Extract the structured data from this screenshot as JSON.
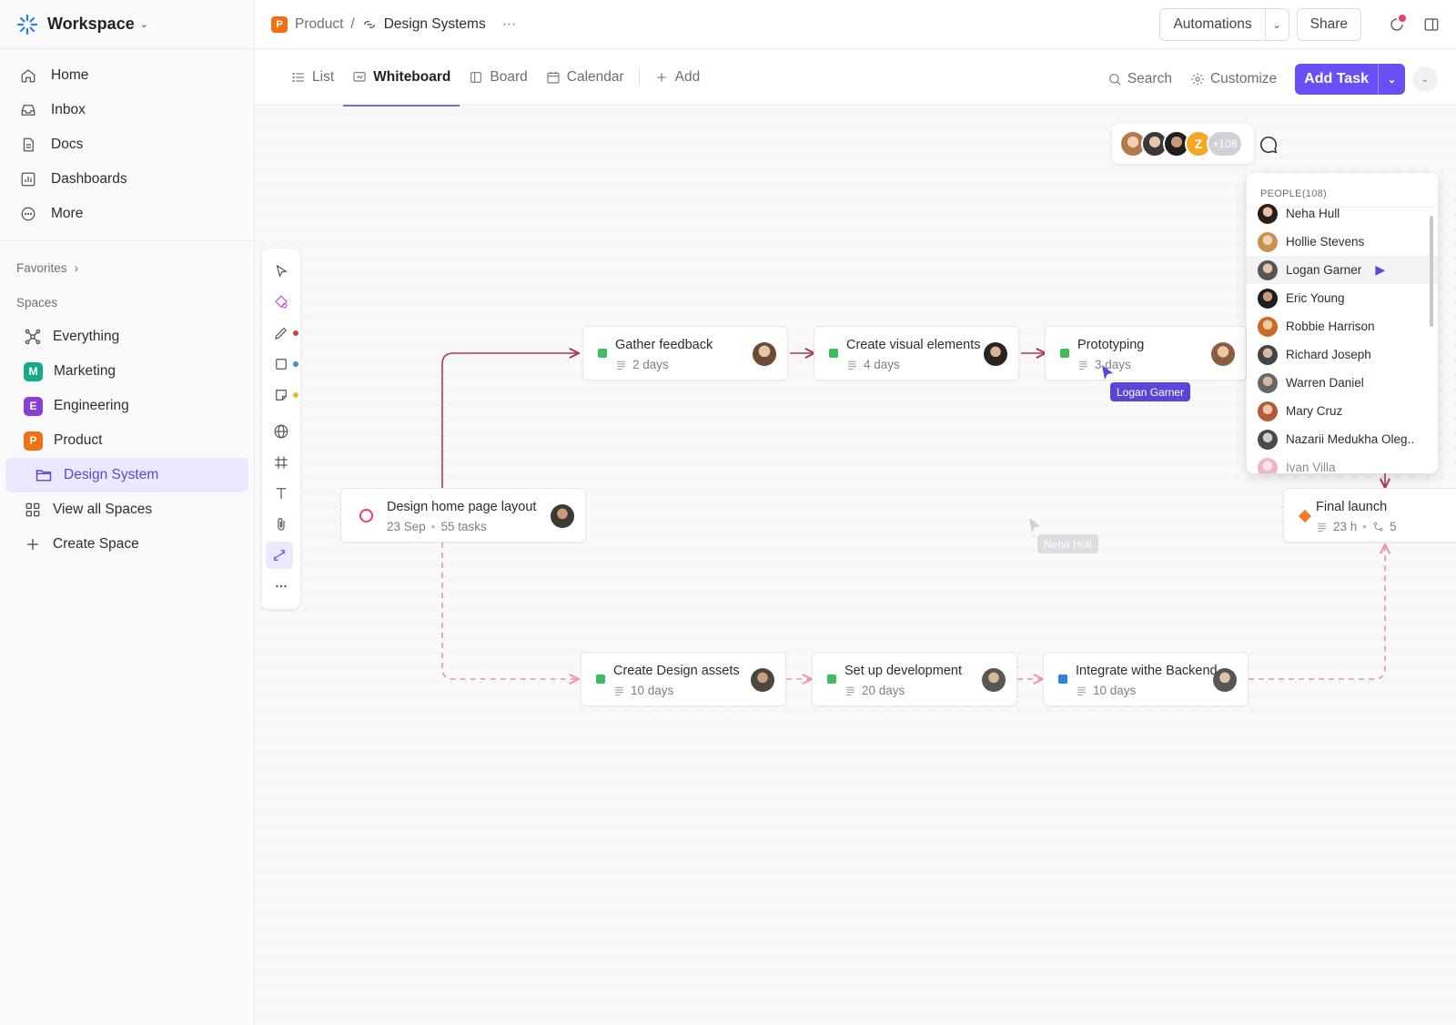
{
  "workspace": {
    "name": "Workspace"
  },
  "nav": [
    {
      "label": "Home",
      "icon": "home-icon"
    },
    {
      "label": "Inbox",
      "icon": "inbox-icon"
    },
    {
      "label": "Docs",
      "icon": "docs-icon"
    },
    {
      "label": "Dashboards",
      "icon": "dashboards-icon"
    },
    {
      "label": "More",
      "icon": "more-icon"
    }
  ],
  "favorites_label": "Favorites",
  "spaces_label": "Spaces",
  "spaces": [
    {
      "label": "Everything",
      "icon": "everything-icon"
    },
    {
      "label": "Marketing",
      "letter": "M",
      "color": "#17a98a"
    },
    {
      "label": "Engineering",
      "letter": "E",
      "color": "#8a3fd1"
    },
    {
      "label": "Product",
      "letter": "P",
      "color": "#f07014"
    },
    {
      "label": "Design System",
      "icon": "folder-icon",
      "selected": true
    },
    {
      "label": "View all Spaces",
      "icon": "grid-icon"
    },
    {
      "label": "Create Space",
      "icon": "plus-icon"
    }
  ],
  "breadcrumb": {
    "space": "Product",
    "space_letter": "P",
    "separator": "/",
    "page": "Design Systems",
    "more": "···"
  },
  "header": {
    "automations": "Automations",
    "share": "Share"
  },
  "views": {
    "tabs": [
      {
        "label": "List",
        "icon": "list-icon"
      },
      {
        "label": "Whiteboard",
        "icon": "whiteboard-icon",
        "active": true
      },
      {
        "label": "Board",
        "icon": "board-icon"
      },
      {
        "label": "Calendar",
        "icon": "calendar-icon"
      }
    ],
    "add": "Add",
    "search": "Search",
    "customize": "Customize",
    "add_task": "Add Task"
  },
  "tool_colors": {
    "pen": "#d0463b",
    "shape": "#3c8fe0",
    "sticky": "#f2b53c"
  },
  "cards": {
    "gather": {
      "title": "Gather feedback",
      "meta": "2 days",
      "color": "#3ebd5d"
    },
    "visual": {
      "title": "Create visual elements",
      "meta": "4 days",
      "color": "#3ebd5d"
    },
    "proto": {
      "title": "Prototyping",
      "meta": "3 days",
      "color": "#3ebd5d"
    },
    "home": {
      "title": "Design home page layout",
      "date": "23 Sep",
      "dot": "•",
      "tasks": "55 tasks",
      "color": "#e9406b"
    },
    "final": {
      "title": "Final launch",
      "hours": "23 h",
      "dot": "•",
      "deps": "5",
      "color": "#f07b2a"
    },
    "assets": {
      "title": "Create Design assets",
      "meta": "10 days",
      "color": "#3ebd5d"
    },
    "dev": {
      "title": "Set up development",
      "meta": "20 days",
      "color": "#3ebd5d"
    },
    "backend": {
      "title": "Integrate withe Backend",
      "meta": "10 days",
      "color": "#2f80e8"
    }
  },
  "avatars": {
    "extra_count": "+108",
    "letter": "Z"
  },
  "people": {
    "header": "PEOPLE(108)",
    "list": [
      "Neha Hull",
      "Hollie Stevens",
      "Logan Garner",
      "Eric Young",
      "Robbie Harrison",
      "Richard Joseph",
      "Warren Daniel",
      "Mary Cruz",
      "Nazarii Medukha Oleg..",
      "Ivan Villa"
    ]
  },
  "cursors": {
    "logan": "Logan Garner",
    "neha": "Neha Hull"
  },
  "colors": {
    "accent": "#6a4ff5",
    "wire": "#b0385c",
    "dashed": "#f08fae"
  }
}
